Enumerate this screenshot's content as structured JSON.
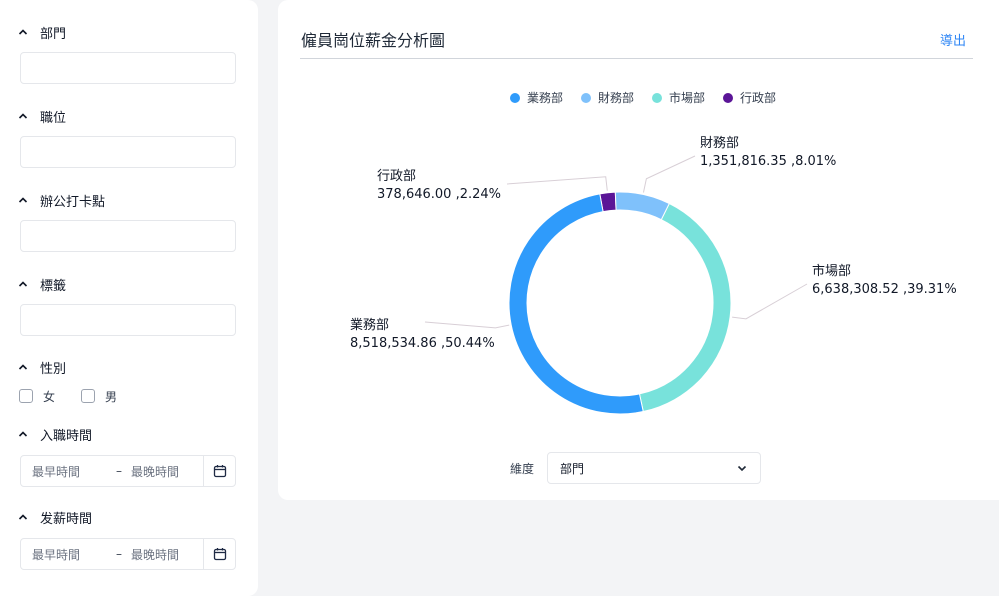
{
  "filters": {
    "sections": [
      {
        "label": "部門"
      },
      {
        "label": "職位"
      },
      {
        "label": "辦公打卡點"
      },
      {
        "label": "標籤"
      },
      {
        "label": "性別"
      },
      {
        "label": "入職時間"
      },
      {
        "label": "发薪時間"
      }
    ],
    "gender_options": [
      "女",
      "男"
    ],
    "hire_date": {
      "start_placeholder": "最早時間",
      "separator": "–",
      "end_placeholder": "最晚時間"
    },
    "pay_date": {
      "start_placeholder": "最早時間",
      "separator": "–",
      "end_placeholder": "最晚時間"
    }
  },
  "main": {
    "title": "僱員崗位薪金分析圖",
    "export_label": "導出",
    "dimension_label": "維度",
    "dimension_value": "部門"
  },
  "chart_data": {
    "type": "pie",
    "donut": true,
    "legend_position": "top-center",
    "series": [
      {
        "name": "業務部",
        "value": 8518534.86,
        "value_label": "8,518,534.86",
        "percent_label": "50.44%",
        "color": "#2f9bfb"
      },
      {
        "name": "財務部",
        "value": 1351816.35,
        "value_label": "1,351,816.35",
        "percent_label": "8.01%",
        "color": "#7fc1fb"
      },
      {
        "name": "市場部",
        "value": 6638308.52,
        "value_label": "6,638,308.52",
        "percent_label": "39.31%",
        "color": "#78e2db"
      },
      {
        "name": "行政部",
        "value": 378646.0,
        "value_label": "378,646.00",
        "percent_label": "2.24%",
        "color": "#5b1597"
      }
    ]
  }
}
